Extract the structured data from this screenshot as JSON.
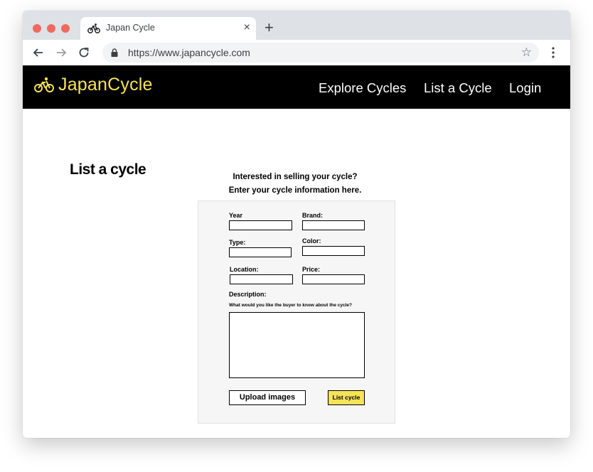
{
  "browser": {
    "tab_title": "Japan Cycle",
    "tab_close": "×",
    "new_tab": "+",
    "url": "https://www.japancycle.com",
    "bookmark_star": "☆"
  },
  "header": {
    "logo_text": "JapanCycle",
    "nav": {
      "explore": "Explore Cycles",
      "list": "List a Cycle",
      "login": "Login"
    }
  },
  "page": {
    "title": "List a cycle",
    "intro_line1": "Interested in selling your cycle?",
    "intro_line2": "Enter your cycle information here."
  },
  "form": {
    "year_label": "Year",
    "brand_label": "Brand:",
    "type_label": "Type:",
    "color_label": "Color:",
    "location_label": "Location:",
    "price_label": "Price:",
    "description_label": "Description:",
    "description_hint": "What would you like the buyer to know about the cycle?",
    "upload_label": "Upload images",
    "submit_label": "List cycle"
  },
  "colors": {
    "accent": "#f7e358",
    "header_bg": "#000000",
    "window_controls": "#ee6a5f"
  },
  "icons": [
    "bicycle-icon",
    "back-arrow-icon",
    "forward-arrow-icon",
    "reload-icon",
    "lock-icon",
    "star-icon",
    "kebab-menu-icon"
  ]
}
